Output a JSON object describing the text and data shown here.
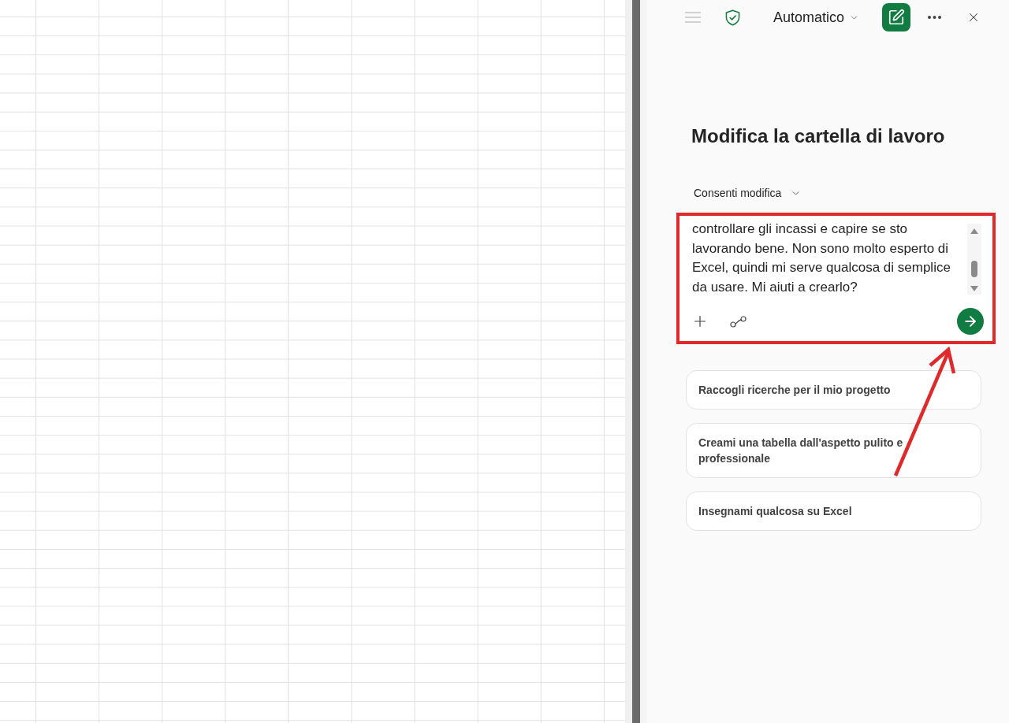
{
  "top_bar": {
    "menu_button": {
      "disabled": true
    },
    "mode_dropdown": {
      "label": "Automatico"
    }
  },
  "heading": "Modifica la cartella di lavoro",
  "permission_dropdown": {
    "label": "Consenti modifica"
  },
  "prompt_box": {
    "lines": [
      "controllare gli incassi e capire se sto",
      "lavorando bene. Non sono molto esperto di",
      "Excel, quindi mi serve qualcosa di semplice",
      "da usare. Mi aiuti a crearlo?"
    ]
  },
  "suggestions": [
    {
      "text": "Raccogli ricerche per il mio progetto"
    },
    {
      "text": "Creami una tabella dall'aspetto pulito e professionale"
    },
    {
      "text": "Insegnami qualcosa su Excel"
    }
  ]
}
